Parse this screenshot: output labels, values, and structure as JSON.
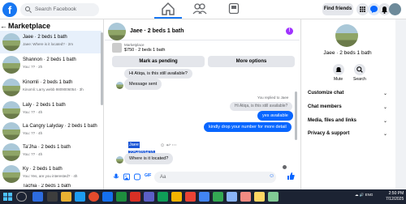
{
  "topbar": {
    "logo": "f",
    "search_placeholder": "Search Facebook",
    "find_friends": "Find friends",
    "icons": [
      "home-icon",
      "friends-icon",
      "gaming-icon",
      "menu-grid-icon",
      "messenger-icon",
      "notifications-icon",
      "avatar"
    ]
  },
  "sidebar": {
    "title": "Marketplace",
    "back": "←",
    "conversations": [
      {
        "name": "Jaee · 2 beds 1 bath",
        "sub": "Jaee: Where is it located? · 2m",
        "active": true
      },
      {
        "name": "Shannon · 2 beds 1 bath",
        "sub": "You: ?? · 2h"
      },
      {
        "name": "Kinomli · 2 beds 1 bath",
        "sub": "Kinomli: Larry webb 9809006054 · 3h"
      },
      {
        "name": "Laly · 2 beds 1 bath",
        "sub": "You: ?? · 4h"
      },
      {
        "name": "La Cangry Lalyday · 2 beds 1 bath",
        "sub": "You: ?? · 4h"
      },
      {
        "name": "Ta'Jha · 2 beds 1 bath",
        "sub": "You: ?? · 4h"
      },
      {
        "name": "Ky · 2 beds 1 bath",
        "sub": "You: Yes, are you interested? · 4h"
      },
      {
        "name": "Tachia · 2 beds 1 bath",
        "sub": ""
      }
    ]
  },
  "chat": {
    "title": "Jaee · 2 beds 1 bath",
    "badge": "!",
    "listing_label": "Marketplace",
    "listing_price": "$750 · 2 beds 1 bath",
    "mark_pending": "Mark as pending",
    "more_options": "More options",
    "messages": {
      "m1": "Hi Atiqa, is this still available?",
      "m2": "Message sent",
      "reply_note": "You replied to Jaee",
      "reply_quote": "Hi Atiqa, is this still available?",
      "m3": "yes available",
      "m4": "kindly drop your number for more detail",
      "sel1": "Jaee",
      "sel2": "2254659410",
      "m5": "Where is it located?"
    },
    "composer_placeholder": "Aa",
    "colors": {
      "outgoing": "#0866ff",
      "incoming": "#e4e6eb",
      "accent": "#1877f2"
    }
  },
  "details": {
    "name": "Jaee · 2 beds 1 bath",
    "mute": "Mute",
    "search": "Search",
    "rows": [
      "Customize chat",
      "Chat members",
      "Media, files and links",
      "Privacy & support"
    ]
  },
  "taskbar": {
    "weather": "☁ 🔊 ENG",
    "time": "2:50 PM",
    "date": "7/12/2025"
  }
}
